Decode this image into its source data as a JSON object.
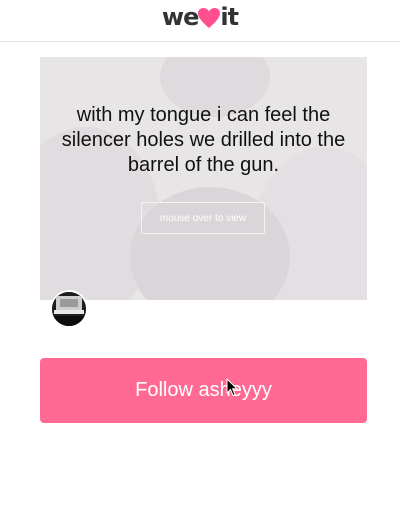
{
  "header": {
    "logo_prefix": "we",
    "logo_suffix": "it",
    "logo_heart_icon": "heart-icon",
    "brand_color": "#ff4f8e"
  },
  "card": {
    "quote": "with my tongue i can feel the silencer holes we drilled into the barrel of the gun.",
    "mouse_over_label": "mouse over to view",
    "background_color": "#e8e5e7"
  },
  "follow": {
    "label": "Follow asheyyy",
    "color": "#ff6994"
  }
}
